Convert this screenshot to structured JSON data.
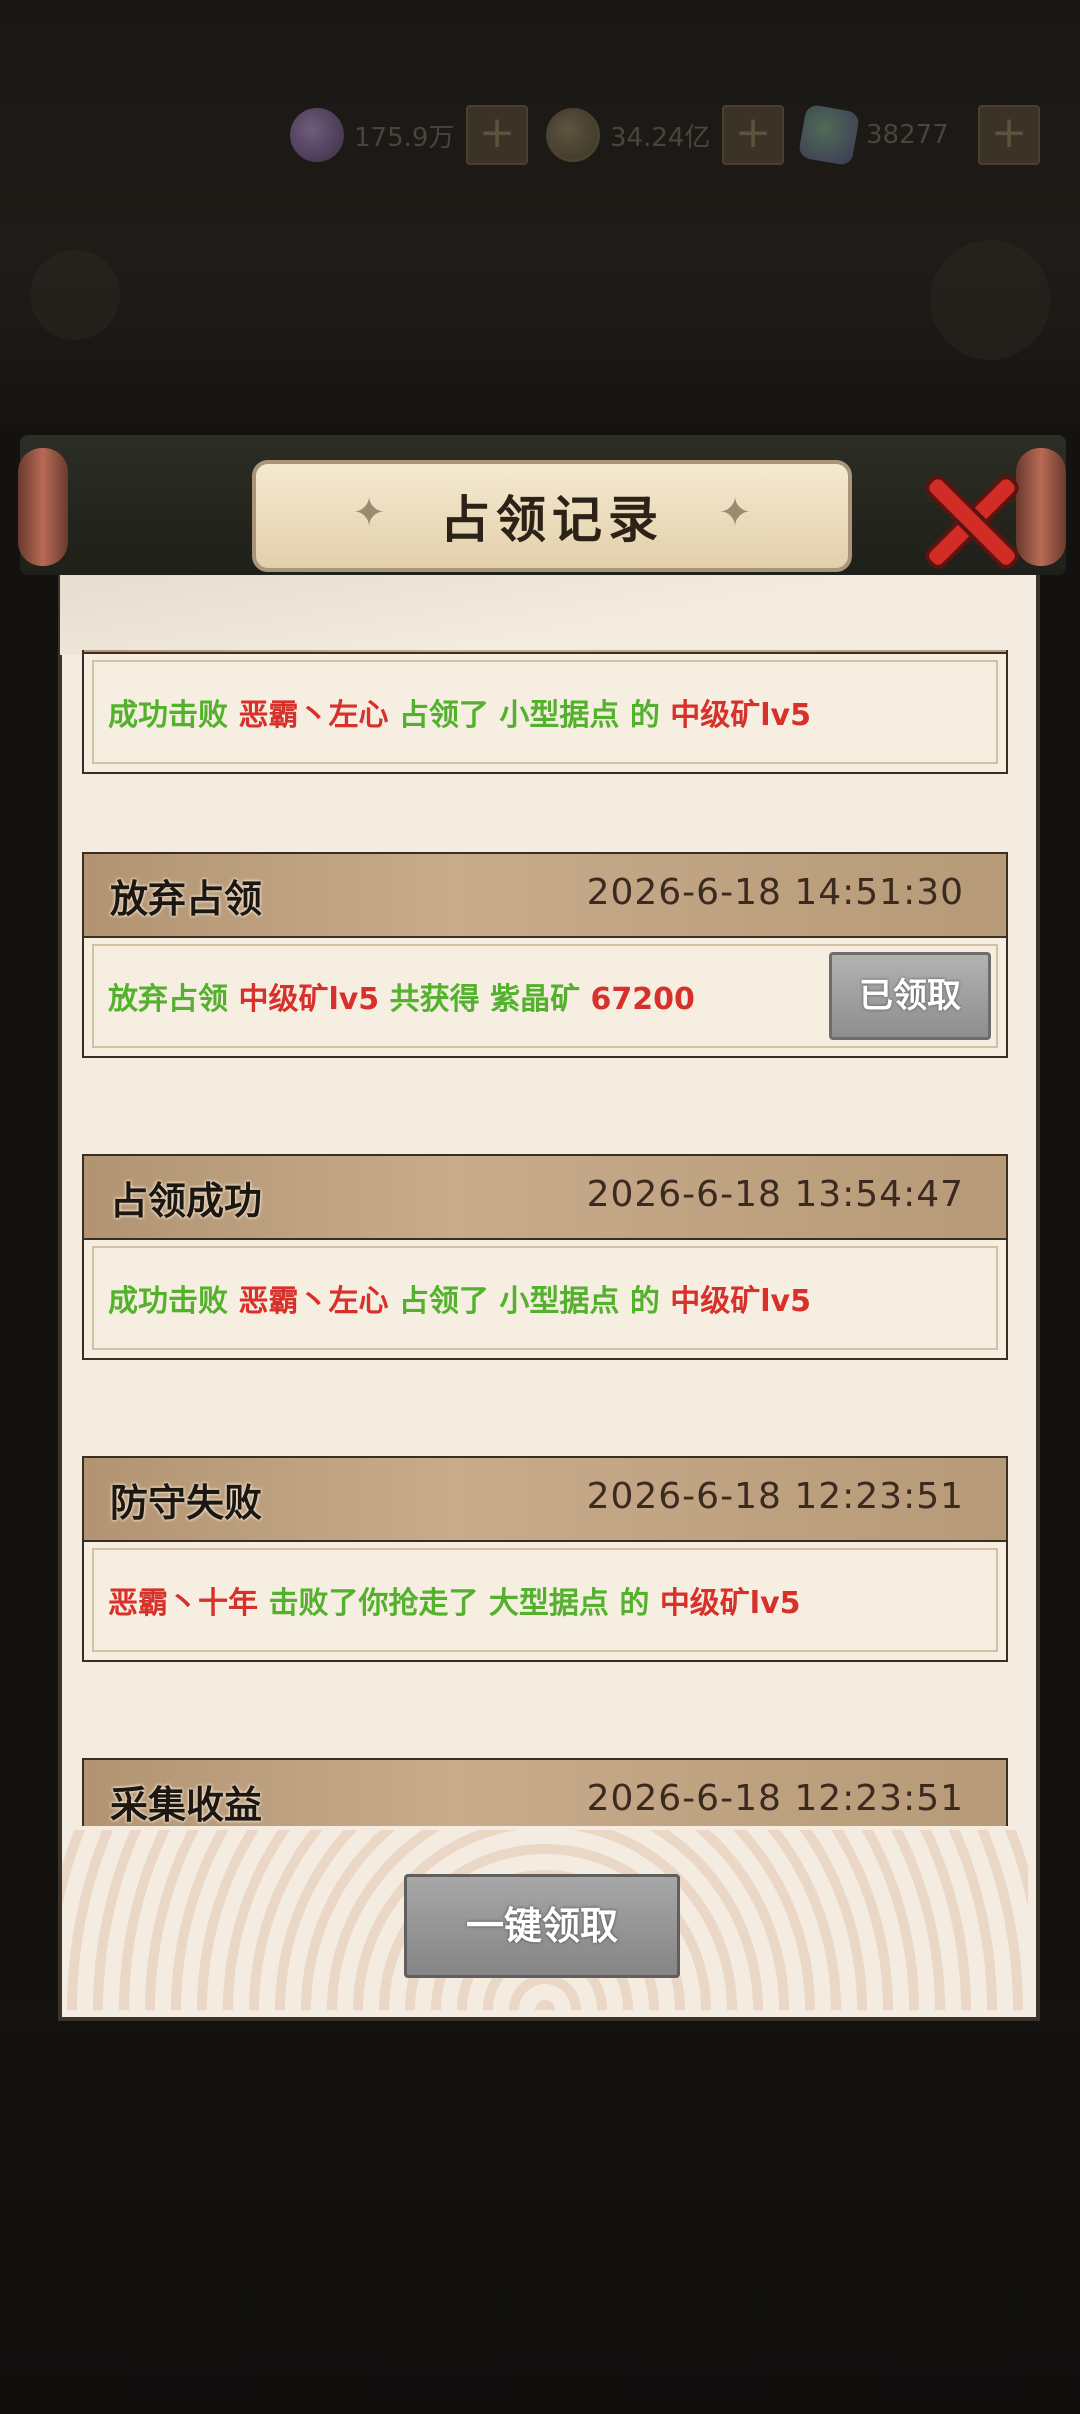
{
  "currency": [
    {
      "icon": "purple-gem-icon",
      "value": "175.9万",
      "plus": "+"
    },
    {
      "icon": "coin-icon",
      "value": "34.24亿",
      "plus": "+"
    },
    {
      "icon": "crystal-icon",
      "value": "38277",
      "plus": "+"
    }
  ],
  "dialog": {
    "title": "占领记录",
    "close_icon": "close-icon",
    "collect_all_label": "一键领取"
  },
  "entries": [
    {
      "title": "",
      "time": "",
      "text": [
        {
          "t": "成功击败",
          "c": "g"
        },
        {
          "t": "恶霸丶左心",
          "c": "r"
        },
        {
          "t": "占领了",
          "c": "g"
        },
        {
          "t": "小型据点",
          "c": "g"
        },
        {
          "t": "的",
          "c": "g"
        },
        {
          "t": "中级矿lv5",
          "c": "r"
        }
      ]
    },
    {
      "title": "放弃占领",
      "time": "2026-6-18  14:51:30",
      "button": "已领取",
      "text": [
        {
          "t": "放弃占领",
          "c": "g"
        },
        {
          "t": "中级矿lv5",
          "c": "r"
        },
        {
          "t": "共获得",
          "c": "g"
        },
        {
          "t": "紫晶矿",
          "c": "g"
        },
        {
          "t": "67200",
          "c": "r"
        }
      ]
    },
    {
      "title": "占领成功",
      "time": "2026-6-18  13:54:47",
      "text": [
        {
          "t": "成功击败",
          "c": "g"
        },
        {
          "t": "恶霸丶左心",
          "c": "r"
        },
        {
          "t": "占领了",
          "c": "g"
        },
        {
          "t": "小型据点",
          "c": "g"
        },
        {
          "t": "的",
          "c": "g"
        },
        {
          "t": "中级矿lv5",
          "c": "r"
        }
      ]
    },
    {
      "title": "防守失败",
      "time": "2026-6-18  12:23:51",
      "text": [
        {
          "t": "恶霸丶十年",
          "c": "r"
        },
        {
          "t": "击败了你抢走了",
          "c": "g"
        },
        {
          "t": "大型据点",
          "c": "g"
        },
        {
          "t": "的",
          "c": "g"
        },
        {
          "t": "中级矿lv5",
          "c": "r"
        }
      ]
    },
    {
      "title": "采集收益",
      "time": "2026-6-18  12:23:51",
      "text": []
    }
  ]
}
